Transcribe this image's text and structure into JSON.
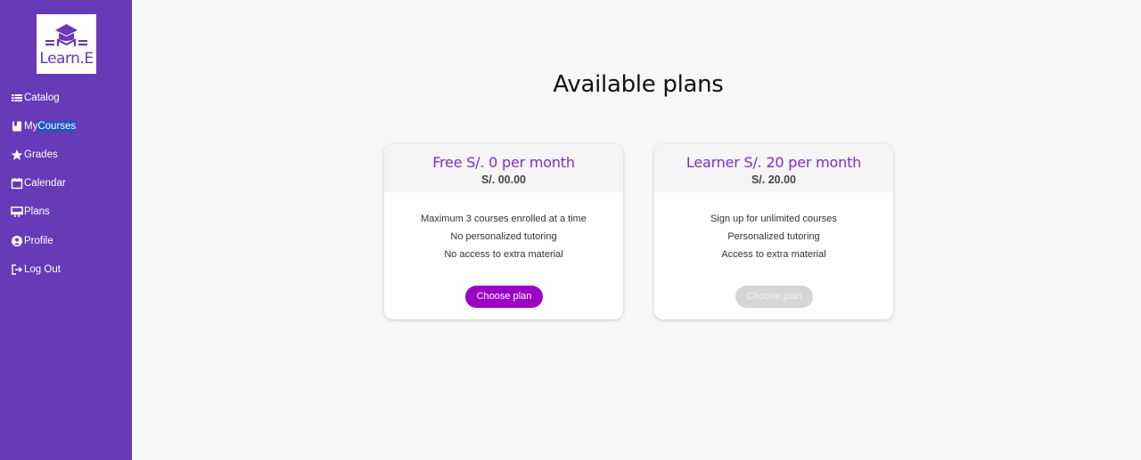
{
  "app": {
    "logo_text": "Learn.E",
    "brand_color": "#673ab7"
  },
  "sidebar": {
    "items": [
      {
        "label": "Catalog",
        "icon": "list-icon"
      },
      {
        "label_a": "My ",
        "label_b": "Courses",
        "icon": "book-icon"
      },
      {
        "label": "Grades",
        "icon": "star-icon"
      },
      {
        "label": "Calendar",
        "icon": "calendar-icon"
      },
      {
        "label": "Plans",
        "icon": "monitor-icon"
      },
      {
        "label": "Profile",
        "icon": "account-circle-icon"
      },
      {
        "label": "Log Out",
        "icon": "logout-icon"
      }
    ]
  },
  "main": {
    "title": "Available plans",
    "plans": [
      {
        "name": "Free S/. 0 per month",
        "price": "S/. 00.00",
        "features": [
          "Maximum 3 courses enrolled at a time",
          "No personalized tutoring",
          "No access to extra material"
        ],
        "button": "Choose plan",
        "button_state": "enabled"
      },
      {
        "name": "Learner S/. 20 per month",
        "price": "S/. 20.00",
        "features": [
          "Sign up for unlimited courses",
          "Personalized tutoring",
          "Access to extra material"
        ],
        "button": "Choose plan",
        "button_state": "disabled"
      }
    ]
  }
}
